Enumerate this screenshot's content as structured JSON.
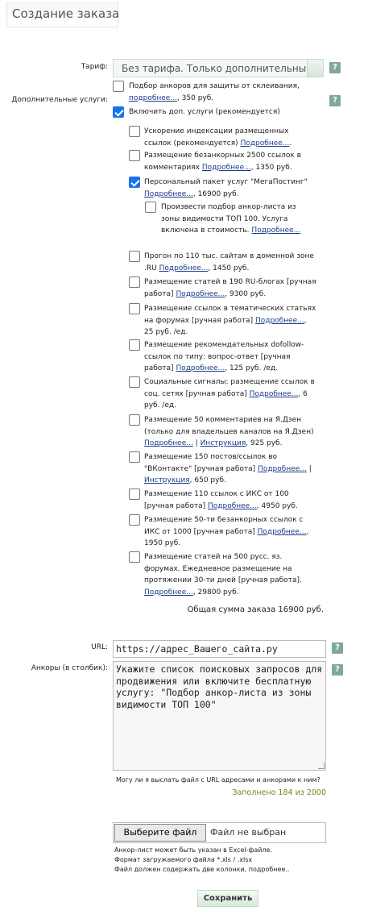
{
  "title": "Создание заказа",
  "help_glyph": "?",
  "tariff": {
    "label": "Тариф:",
    "value": "Без тарифа. Только дополнительные услуги"
  },
  "extra": {
    "label": "Дополнительные услуги:"
  },
  "top_options": [
    {
      "text": "Подбор анкоров для защиты от склеивания,",
      "link": "подробнее...",
      "price": ",   350 руб.",
      "checked": false
    },
    {
      "text": "Включить доп. услуги (рекомендуется)",
      "checked": true
    }
  ],
  "services": [
    {
      "text": "Ускорение индексации размещенных ссылок (рекомендуется)",
      "link": "Подробнее...",
      "tail": ".",
      "checked": false
    },
    {
      "text": "Размещение безанкорных 2500 ссылок в комментариях",
      "link": "Подробнее...",
      "tail": ",   1350 руб.",
      "checked": false
    },
    {
      "text": "Персональный пакет услуг \"МегаПостинг\"",
      "link": "Подробнее...",
      "tail": ",   16900 руб.",
      "checked": true
    },
    {
      "text": "Прогон по 110 тыс. сайтам в доменной зоне .RU",
      "link": "Подробнее...",
      "tail": ",   1450 руб.",
      "checked": false
    },
    {
      "text": "Размещение статей в 190 RU-блогах [ручная работа]",
      "link": "Подробнее...",
      "tail": ",   9300 руб.",
      "checked": false
    },
    {
      "text": "Размещение ссылок в тематических статьях на форумах [ручная работа]",
      "link": "Подробнее...",
      "tail": ",   25 руб. /ед.",
      "checked": false
    },
    {
      "text": "Размещение рекомендательных dofollow-ссылок по типу: вопрос-ответ [ручная работа]",
      "link": "Подробнее...",
      "tail": ",   125 руб. /ед.",
      "checked": false
    },
    {
      "text": "Социальные сигналы: размещение ссылок в соц. сетях [ручная работа]",
      "link": "Подробнее...",
      "tail": ",   6 руб. /ед.",
      "checked": false
    },
    {
      "text": "Размещение 50 комментариев на Я.Дзен (только для владельцев каналов на Я.Дзен)",
      "link": "Подробнее...",
      "sep": " | ",
      "link2": "Инструкция",
      "tail": ",   925 руб.",
      "checked": false
    },
    {
      "text": "Размещение 150 постов/ссылок во \"ВКонтакте\" [ручная работа]",
      "link": "Подробнее...",
      "sep": " | ",
      "link2": "Инструкция",
      "tail": ",   650 руб.",
      "checked": false
    },
    {
      "text": "Размещение 110 ссылок с ИКС от 100 [ручная работа]",
      "link": "Подробнее...",
      "tail": ",   4950 руб.",
      "checked": false
    },
    {
      "text": "Размещение 50-ти безанкорных ссылок с ИКС от 1000 [ручная работа]",
      "link": "Подробнее...",
      "tail": ",   1950 руб.",
      "checked": false
    },
    {
      "text": "Размещение статей на 500 русс. яз. форумах. Ежедневное размещение на протяжении 30-ти дней [ручная работа].",
      "link": "Подробнее...",
      "tail": ",   29800 руб.",
      "checked": false
    }
  ],
  "sub_option": {
    "text": "Произвести подбор анкор-листа из зоны видимости ТОП 100. Услуга включена в стоимость.",
    "link": "Подробнее...",
    "checked": false
  },
  "total": "Общая сумма заказа 16900 руб.",
  "url": {
    "label": "URL:",
    "value": "https://адрес_Вашего_сайта.ру"
  },
  "anchors": {
    "label": "Анкоры (в столбик):",
    "value": "Укажите список поисковых запросов для продвижения или включите бесплатную услугу: \"Подбор анкор-листа из зоны видимости ТОП 100\""
  },
  "file_question": "Могу ли я выслать файл с URL адресами и анкорами к ним?",
  "filled": "Заполнено 184 из 2000",
  "file": {
    "button": "Выберите файл",
    "status": "Файл не выбран"
  },
  "file_notes": [
    "Анкор-лист может быть указан в Excel-файле.",
    "Формат загружаемого файла *.xls / .xlsx",
    "Файл должен содержать две колонки, подробнее.."
  ],
  "save": "Сохранить"
}
